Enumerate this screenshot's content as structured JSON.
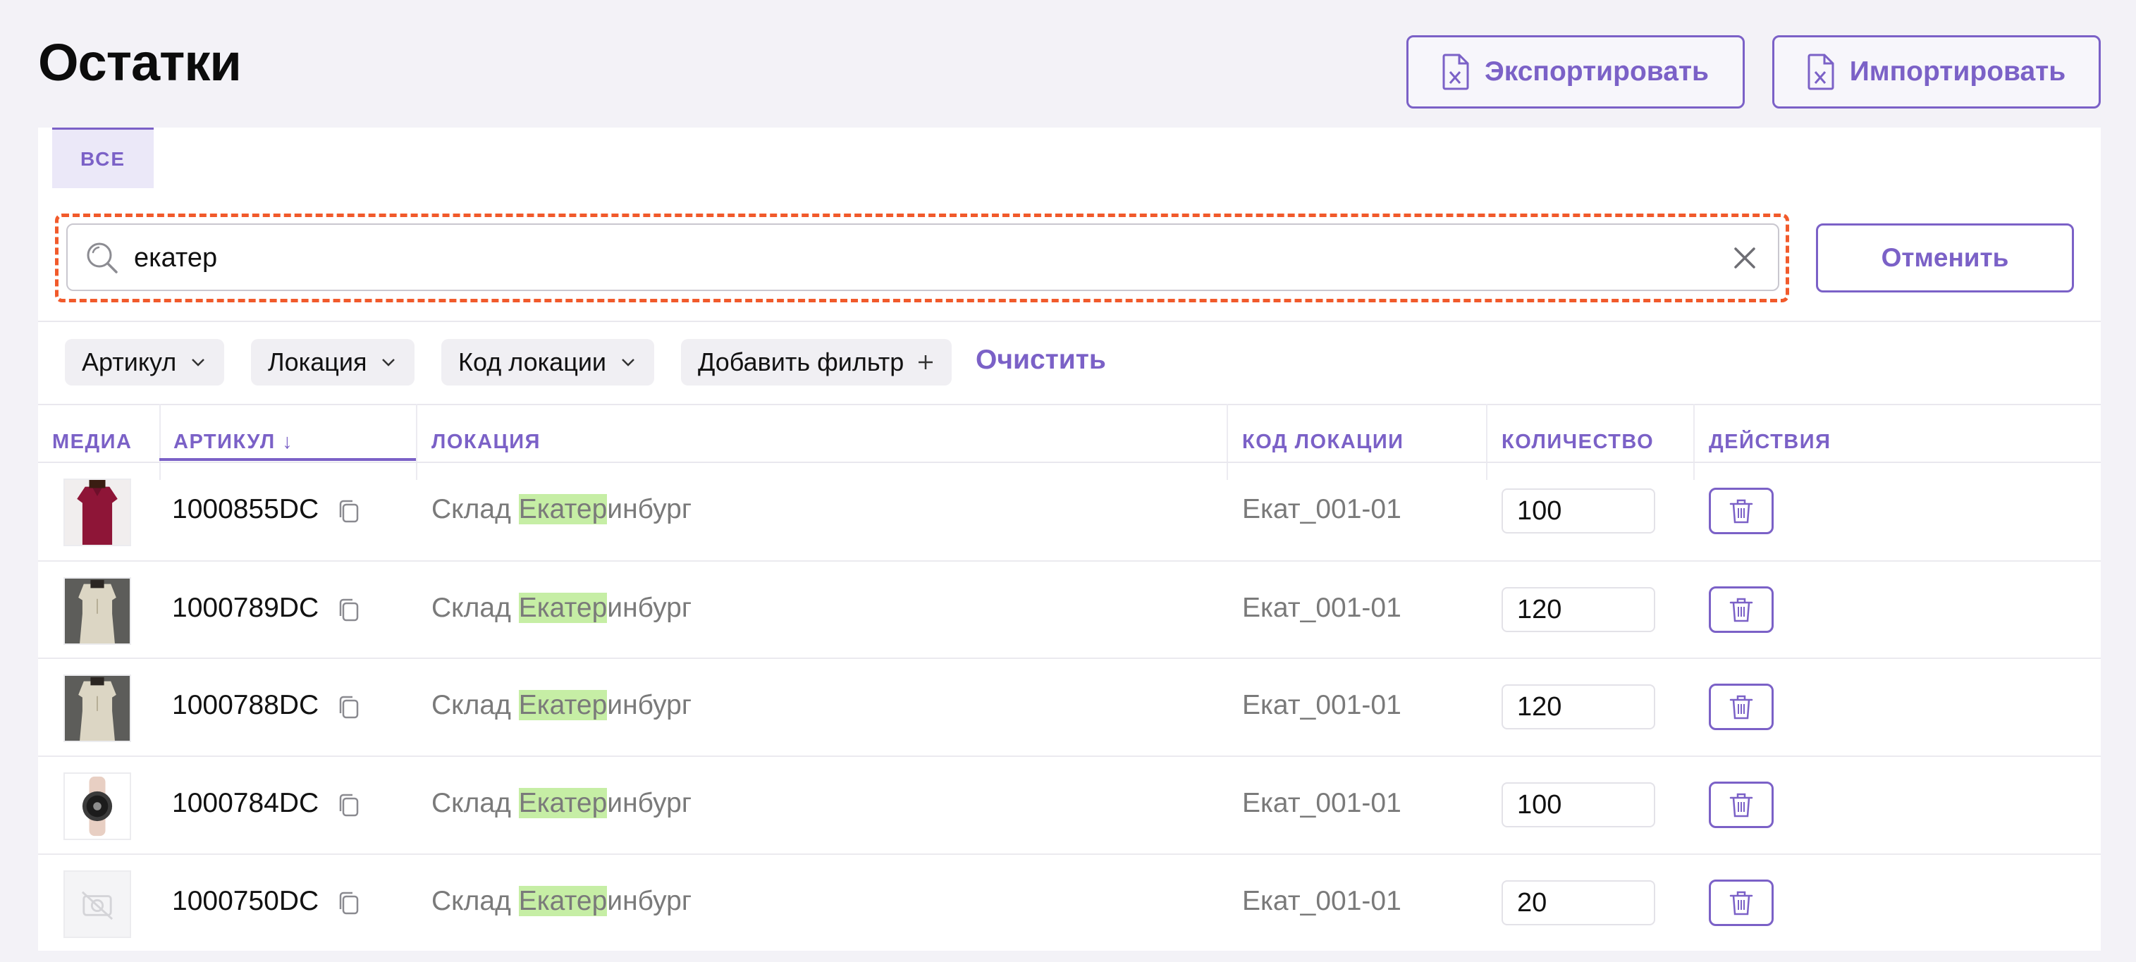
{
  "page": {
    "title": "Остатки",
    "export_label": "Экспортировать",
    "import_label": "Импортировать",
    "accent_color": "#7b61c7"
  },
  "tabs": [
    {
      "label": "ВСЕ",
      "active": true
    }
  ],
  "search": {
    "value": "екатер",
    "placeholder": "",
    "cancel_label": "Отменить"
  },
  "filters": {
    "chips": [
      "Артикул",
      "Локация",
      "Код локации"
    ],
    "add_label": "Добавить фильтр",
    "clear_label": "Очистить"
  },
  "table": {
    "headers": {
      "media": "МЕДИА",
      "sku": "АРТИКУЛ ↓",
      "location": "ЛОКАЦИЯ",
      "location_code": "КОД ЛОКАЦИИ",
      "quantity": "КОЛИЧЕСТВО",
      "actions": "ДЕЙСТВИЯ"
    },
    "rows": [
      {
        "sku": "1000855DC",
        "location_prefix": "Склад ",
        "location_match": "Екатер",
        "location_suffix": "инбург",
        "code": "Екат_001-01",
        "qty": "100",
        "thumb": "burgundy-blouse"
      },
      {
        "sku": "1000789DC",
        "location_prefix": "Склад ",
        "location_match": "Екатер",
        "location_suffix": "инбург",
        "code": "Екат_001-01",
        "qty": "120",
        "thumb": "beige-suit"
      },
      {
        "sku": "1000788DC",
        "location_prefix": "Склад ",
        "location_match": "Екатер",
        "location_suffix": "инбург",
        "code": "Екат_001-01",
        "qty": "120",
        "thumb": "beige-suit"
      },
      {
        "sku": "1000784DC",
        "location_prefix": "Склад ",
        "location_match": "Екатер",
        "location_suffix": "инбург",
        "code": "Екат_001-01",
        "qty": "100",
        "thumb": "smartwatch"
      },
      {
        "sku": "1000750DC",
        "location_prefix": "Склад ",
        "location_match": "Екатер",
        "location_suffix": "инбург",
        "code": "Екат_001-01",
        "qty": "20",
        "thumb": "no-image"
      }
    ]
  }
}
